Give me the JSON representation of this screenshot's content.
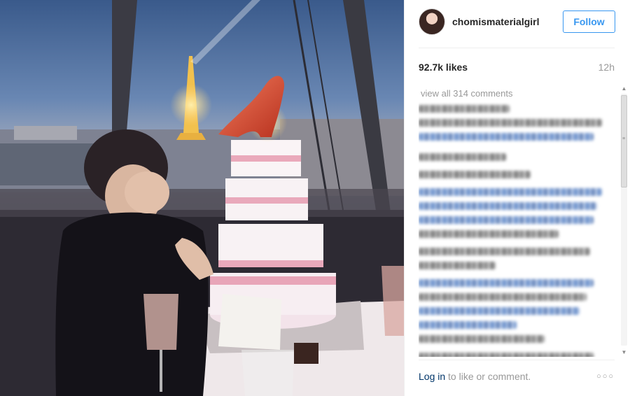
{
  "post": {
    "image_alt": "",
    "username": "chomismaterialgirl",
    "follow_label": "Follow",
    "likes": "92.7k likes",
    "age": "12h",
    "view_all_comments": "view all 314 comments",
    "login_link": "Log in",
    "login_suffix": " to like or comment.",
    "more_icon": "more-options-icon"
  },
  "colors": {
    "follow_blue": "#3897f0",
    "link_dark": "#003569",
    "muted": "#999999",
    "text": "#262626"
  }
}
